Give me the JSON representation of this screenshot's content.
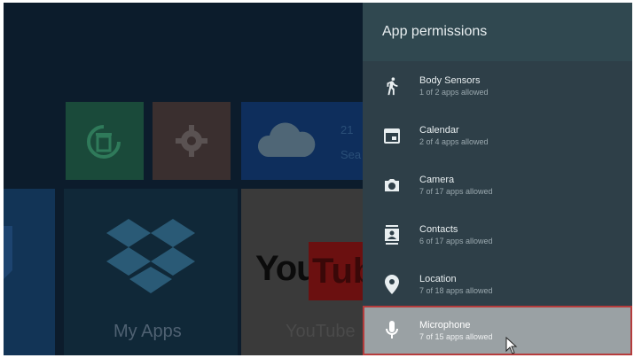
{
  "panel": {
    "title": "App permissions",
    "items": [
      {
        "name": "Body Sensors",
        "status": "1 of 2 apps allowed",
        "icon": "walk-icon"
      },
      {
        "name": "Calendar",
        "status": "2 of 4 apps allowed",
        "icon": "calendar-icon"
      },
      {
        "name": "Camera",
        "status": "7 of 17 apps allowed",
        "icon": "camera-icon"
      },
      {
        "name": "Contacts",
        "status": "6 of 17 apps allowed",
        "icon": "contacts-icon"
      },
      {
        "name": "Location",
        "status": "7 of 18 apps allowed",
        "icon": "location-pin-icon"
      },
      {
        "name": "Microphone",
        "status": "7 of 15 apps allowed",
        "icon": "microphone-icon"
      }
    ],
    "selected_index": 5
  },
  "background": {
    "my_apps_label": "My Apps",
    "youtube_label": "YouTube",
    "youtube_logo_word": "You",
    "youtube_logo_box": "Tub",
    "weather_line1": "21",
    "weather_line2": "Sea"
  },
  "colors": {
    "panel_bg": "#2e3f48",
    "header_bg": "#304850",
    "selected_bg": "#9aa1a4",
    "selected_outline": "#b53c3c"
  }
}
